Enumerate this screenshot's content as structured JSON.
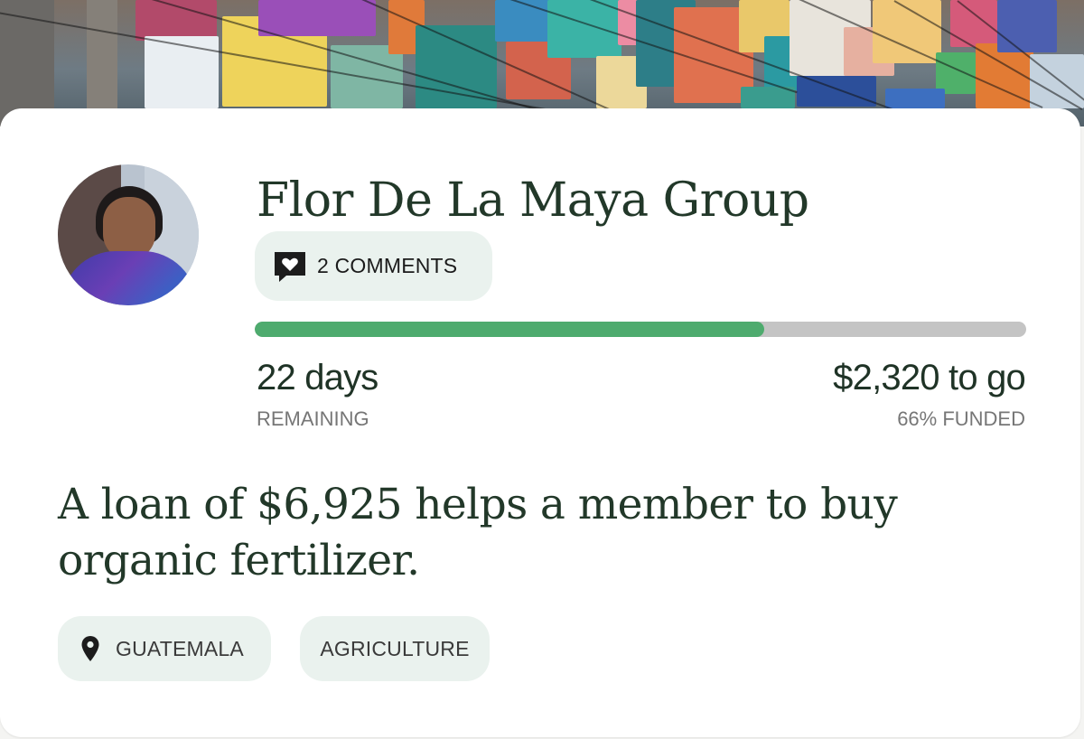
{
  "loan": {
    "borrower_name": "Flor De La Maya Group",
    "comments_label": "2 COMMENTS",
    "funded_fraction": 0.66,
    "days_remaining": "22 days",
    "days_remaining_caption": "REMAINING",
    "amount_to_go": "$2,320 to go",
    "funded_caption": "66% FUNDED",
    "description": "A loan of $6,925 helps a member to buy organic fertilizer.",
    "country": "GUATEMALA",
    "sector": "AGRICULTURE"
  },
  "colors": {
    "heading_text": "#223829",
    "progress_fill": "#4eab6e",
    "progress_track": "#c4c4c4",
    "chip_background": "#eaf2ee"
  },
  "icons": {
    "comments": "speech-bubble-heart-icon",
    "country": "map-pin-icon"
  }
}
